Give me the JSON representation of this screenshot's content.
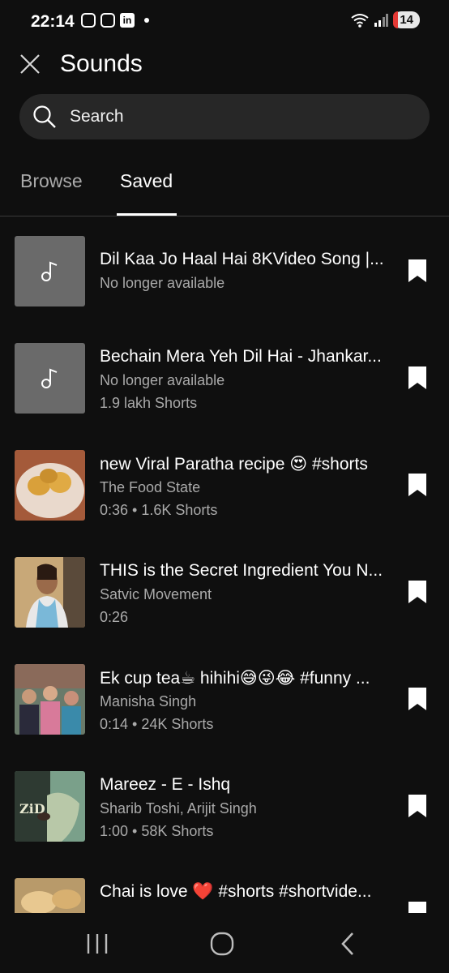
{
  "status": {
    "time": "22:14",
    "battery": "14"
  },
  "header": {
    "title": "Sounds"
  },
  "search": {
    "placeholder": "Search"
  },
  "tabs": [
    {
      "label": "Browse"
    },
    {
      "label": "Saved"
    }
  ],
  "items": [
    {
      "title": "Dil Kaa Jo Haal Hai 8KVideo Song |...",
      "line1": "No longer available",
      "line2": ""
    },
    {
      "title": "Bechain Mera Yeh Dil Hai - Jhankar...",
      "line1": "No longer available",
      "line2": "1.9 lakh Shorts"
    },
    {
      "title": "new Viral Paratha recipe 😍 #shorts",
      "line1": "The Food State",
      "line2": "0:36 • 1.6K Shorts"
    },
    {
      "title": "THIS is the Secret Ingredient You N...",
      "line1": "Satvic Movement",
      "line2": "0:26"
    },
    {
      "title": "Ek cup tea☕ hihihi😅😜😂 #funny ...",
      "line1": "Manisha Singh",
      "line2": "0:14 • 24K Shorts"
    },
    {
      "title": "Mareez - E - Ishq",
      "line1": "Sharib Toshi, Arijit Singh",
      "line2": "1:00 • 58K Shorts"
    },
    {
      "title": "Chai is love ❤️  #shorts #shortvide...",
      "line1": "",
      "line2": ""
    }
  ]
}
